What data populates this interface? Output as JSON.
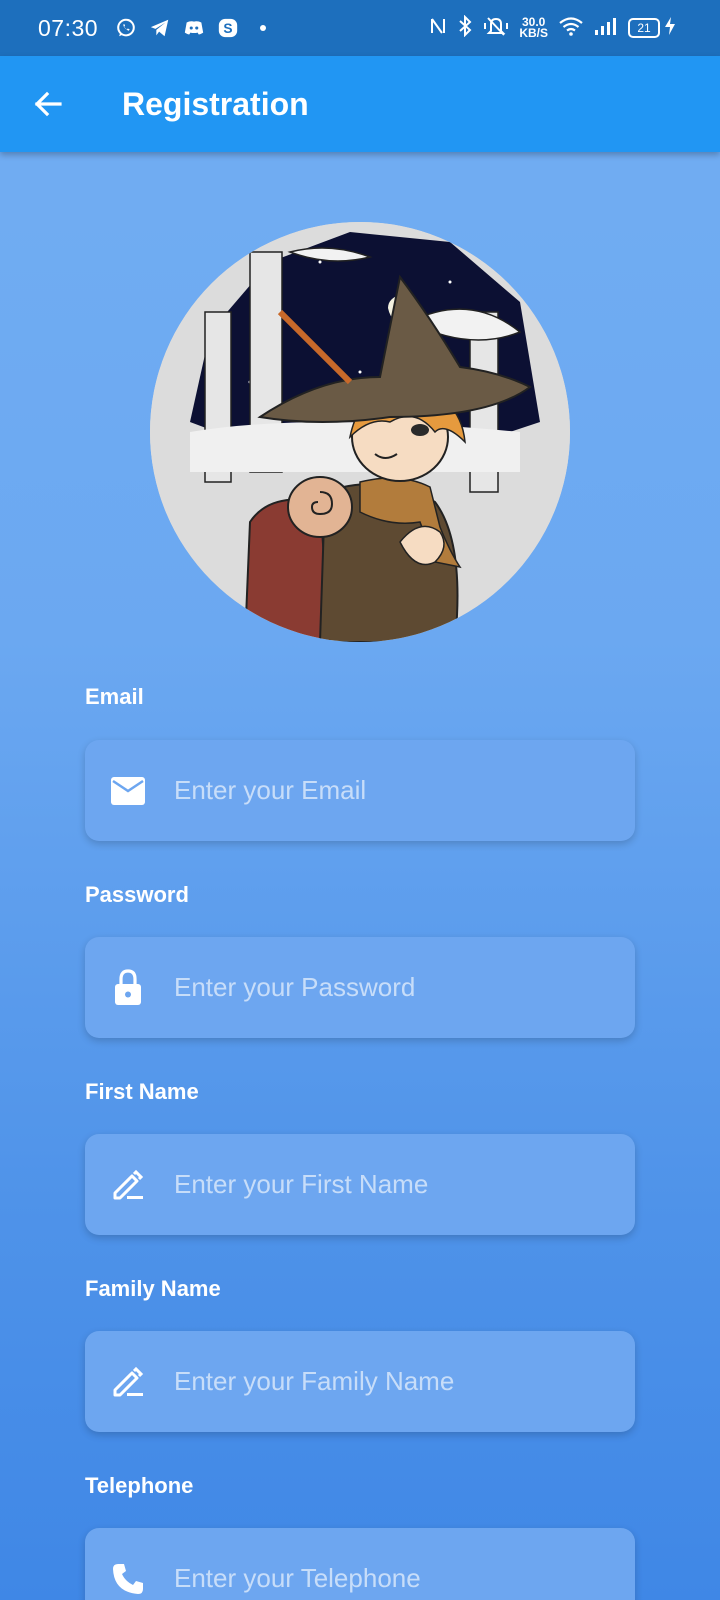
{
  "status_bar": {
    "time": "07:30",
    "apps": [
      "whatsapp-icon",
      "telegram-icon",
      "discord-icon",
      "skype-icon"
    ],
    "net_speed_value": "30.0",
    "net_speed_unit": "KB/S",
    "battery": "21"
  },
  "app_bar": {
    "title": "Registration",
    "background": "#2196f3"
  },
  "form": {
    "fields": [
      {
        "label": "Email",
        "placeholder": "Enter your Email",
        "value": "",
        "icon": "mail-icon"
      },
      {
        "label": "Password",
        "placeholder": "Enter your Password",
        "value": "",
        "icon": "lock-icon"
      },
      {
        "label": "First Name",
        "placeholder": "Enter your First Name",
        "value": "",
        "icon": "edit-icon"
      },
      {
        "label": "Family Name",
        "placeholder": "Enter your Family Name",
        "value": "",
        "icon": "edit-icon"
      },
      {
        "label": "Telephone",
        "placeholder": "Enter your Telephone",
        "value": "",
        "icon": "phone-icon"
      }
    ]
  }
}
